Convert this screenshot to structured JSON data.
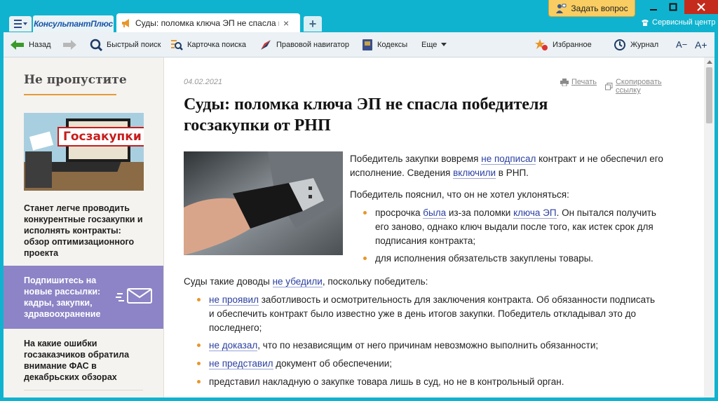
{
  "tabs": {
    "logo_text": "КонсультантПлюс",
    "document_tab_title": "Суды: поломка ключа ЭП не спасла побе",
    "close_glyph": "×",
    "new_tab_glyph": "+"
  },
  "header": {
    "ask_question": "Задать вопрос",
    "service_center": "Сервисный центр"
  },
  "toolbar": {
    "back": "Назад",
    "quick_search": "Быстрый поиск",
    "search_card": "Карточка поиска",
    "legal_navigator": "Правовой навигатор",
    "codes": "Кодексы",
    "more": "Еще",
    "favorites": "Избранное",
    "journal": "Журнал",
    "font_smaller": "A−",
    "font_larger": "A+"
  },
  "sidebar": {
    "heading": "Не пропустите",
    "promo_image_caption": "Госзакупки",
    "items": [
      {
        "text": "Станет легче проводить конкурентные госзакупки и исполнять контракты: обзор оптимизационного проекта"
      },
      {
        "text": "Подпишитесь на новые рассылки: кадры, закупки, здравоохранение"
      },
      {
        "text": "На какие ошибки госзаказчиков обратила внимание ФАС в декабрьских обзорах"
      }
    ]
  },
  "article": {
    "date": "04.02.2021",
    "print": "Печать",
    "copy_link": "Скопировать ссылку",
    "title": "Суды: поломка ключа ЭП не спасла победителя госзакупки от РНП",
    "p1": {
      "a": "Победитель закупки вовремя ",
      "l1": "не подписал",
      "b": " контракт и не обеспечил его",
      "c": "исполнение. Сведения ",
      "l2": "включили",
      "d": " в РНП."
    },
    "p2": "Победитель пояснил, что он не хотел уклоняться:",
    "b1": {
      "a": "просрочка ",
      "l1": "была",
      "b": " из-за поломки ",
      "l2": "ключа ЭП",
      "c": ". Он пытался получить",
      "d": "его заново, однако ключ выдали после того, как истек срок для",
      "e": "подписания контракта;"
    },
    "b2": "для исполнения обязательств закуплены товары.",
    "p3": {
      "a": "Суды такие доводы ",
      "l1": "не убедили",
      "b": ", поскольку победитель:"
    },
    "c1": {
      "l1": "не проявил",
      "a": " заботливость и осмотрительность для заключения контракта. Об обязанности подписать",
      "b": "и обеспечить контракт было известно уже в день итогов закупки. Победитель откладывал это до",
      "c": "последнего;"
    },
    "c2": {
      "l1": "не доказал",
      "a": ", что по независящим от него причинам невозможно выполнить обязанности;"
    },
    "c3": {
      "l1": "не представил",
      "a": " документ об обеспечении;"
    },
    "c4": "представил накладную о закупке товара лишь в суд, но не в контрольный орган."
  },
  "colors": {
    "frame": "#10b3cf",
    "accent_orange": "#e8962a",
    "link": "#2a3fa0",
    "subscribe_bg": "#8c84c6",
    "ask_button": "#f9cd62"
  }
}
